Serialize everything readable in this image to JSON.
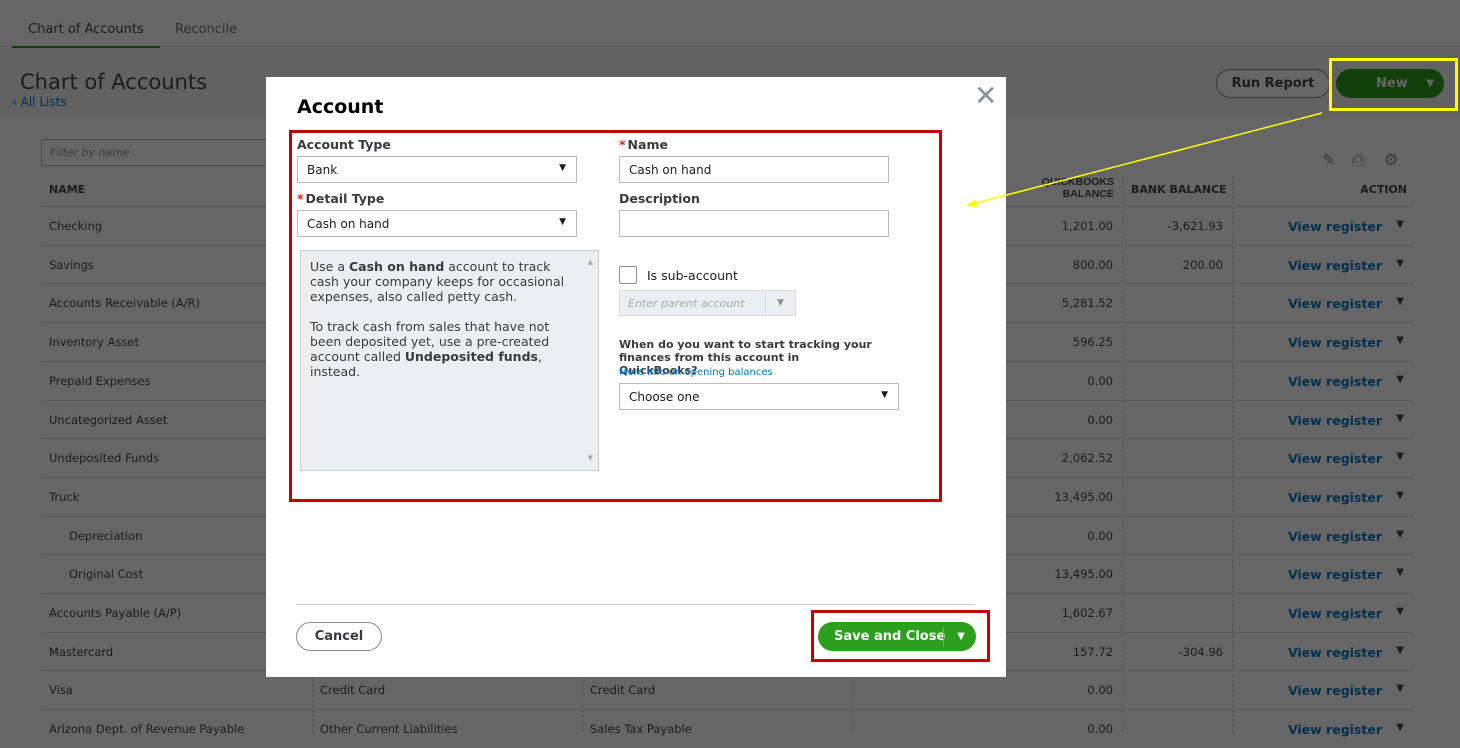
{
  "tabs": [
    {
      "label": "Chart of Accounts",
      "active": true
    },
    {
      "label": "Reconcile",
      "active": false
    }
  ],
  "page": {
    "title": "Chart of Accounts",
    "back_link": "All Lists",
    "run_report": "Run Report",
    "new_button": "New",
    "filter_placeholder": "Filter by name"
  },
  "table": {
    "headers": {
      "name": "NAME",
      "qb_balance": "QUICKBOOKS BALANCE",
      "bank_balance": "BANK BALANCE",
      "action": "ACTION"
    },
    "rows": [
      {
        "name": "Checking",
        "type": "",
        "detail": "",
        "qb": "1,201.00",
        "bank": "-3,621.93",
        "action": "View register"
      },
      {
        "name": "Savings",
        "type": "",
        "detail": "",
        "qb": "800.00",
        "bank": "200.00",
        "action": "View register"
      },
      {
        "name": "Accounts Receivable (A/R)",
        "type": "",
        "detail": "",
        "qb": "5,281.52",
        "bank": "",
        "action": "View register"
      },
      {
        "name": "Inventory Asset",
        "type": "",
        "detail": "",
        "qb": "596.25",
        "bank": "",
        "action": "View register"
      },
      {
        "name": "Prepaid Expenses",
        "type": "",
        "detail": "",
        "qb": "0.00",
        "bank": "",
        "action": "View register"
      },
      {
        "name": "Uncategorized Asset",
        "type": "",
        "detail": "",
        "qb": "0.00",
        "bank": "",
        "action": "View register"
      },
      {
        "name": "Undeposited Funds",
        "type": "",
        "detail": "",
        "qb": "2,062.52",
        "bank": "",
        "action": "View register"
      },
      {
        "name": "Truck",
        "type": "",
        "detail": "",
        "qb": "13,495.00",
        "bank": "",
        "action": "View register"
      },
      {
        "name": "Depreciation",
        "type": "",
        "detail": "",
        "qb": "0.00",
        "bank": "",
        "action": "View register",
        "sub": true
      },
      {
        "name": "Original Cost",
        "type": "",
        "detail": "",
        "qb": "13,495.00",
        "bank": "",
        "action": "View register",
        "sub": true
      },
      {
        "name": "Accounts Payable (A/P)",
        "type": "",
        "detail": "",
        "qb": "1,602.67",
        "bank": "",
        "action": "View register"
      },
      {
        "name": "Mastercard",
        "type": "",
        "detail": "",
        "qb": "157.72",
        "bank": "-304.96",
        "action": "View register"
      },
      {
        "name": "Visa",
        "type": "Credit Card",
        "detail": "Credit Card",
        "qb": "0.00",
        "bank": "",
        "action": "View register"
      },
      {
        "name": "Arizona Dept. of Revenue Payable",
        "type": "Other Current Liabilities",
        "detail": "Sales Tax Payable",
        "qb": "0.00",
        "bank": "",
        "action": "View register"
      }
    ]
  },
  "modal": {
    "title": "Account",
    "account_type_label": "Account Type",
    "account_type_value": "Bank",
    "detail_type_label": "Detail Type",
    "detail_type_value": "Cash on hand",
    "name_label": "Name",
    "name_value": "Cash on hand",
    "description_label": "Description",
    "description_value": "",
    "help": {
      "p1_a": "Use a ",
      "p1_b": "Cash on hand",
      "p1_c": " account to track cash your company keeps for occasional expenses, also called petty cash.",
      "p2_a": "To track cash from sales that have not been deposited yet, use a pre-created account called ",
      "p2_b": "Undeposited funds",
      "p2_c": ", instead."
    },
    "sub_account_label": "Is sub-account",
    "parent_placeholder": "Enter parent account",
    "tracking_question": "When do you want to start tracking your finances from this account in QuickBooks?",
    "more_info_link": "More info on opening balances",
    "tracking_value": "Choose one",
    "cancel": "Cancel",
    "save": "Save and Close"
  },
  "colors": {
    "accent": "#2ca01c",
    "link": "#0077c5",
    "annotation_red": "#c00000",
    "annotation_yellow": "#ffff00"
  }
}
